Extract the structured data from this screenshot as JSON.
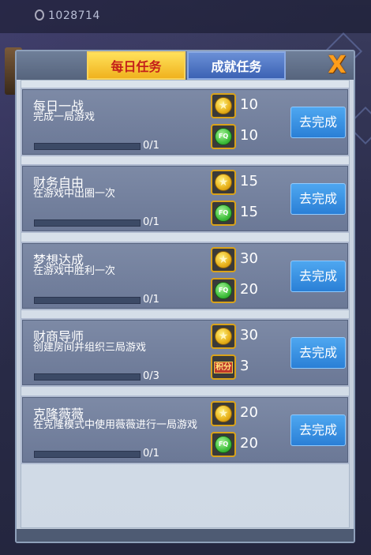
{
  "background": {
    "currency_amount": "1028714"
  },
  "tabs": {
    "daily": "每日任务",
    "achievement": "成就任务"
  },
  "close_label": "X",
  "go_label": "去完成",
  "tasks": [
    {
      "title": "每日一战",
      "description": "完成一局游戏",
      "progress": "0/1",
      "progress_fraction": 0,
      "rewards": [
        {
          "icon": "gold-coin-icon",
          "value": "10"
        },
        {
          "icon": "fq-coin-icon",
          "value": "10"
        }
      ]
    },
    {
      "title": "财务自由",
      "description": "在游戏中出圈一次",
      "progress": "0/1",
      "progress_fraction": 0,
      "rewards": [
        {
          "icon": "gold-coin-icon",
          "value": "15"
        },
        {
          "icon": "fq-coin-icon",
          "value": "15"
        }
      ]
    },
    {
      "title": "梦想达成",
      "description": "在游戏中胜利一次",
      "progress": "0/1",
      "progress_fraction": 0,
      "rewards": [
        {
          "icon": "gold-coin-icon",
          "value": "30"
        },
        {
          "icon": "fq-coin-icon",
          "value": "20"
        }
      ]
    },
    {
      "title": "财商导师",
      "description": "创建房间并组织三局游戏",
      "progress": "0/3",
      "progress_fraction": 0,
      "rewards": [
        {
          "icon": "gold-coin-icon",
          "value": "30"
        },
        {
          "icon": "points-icon",
          "label": "积分",
          "value": "3"
        }
      ]
    },
    {
      "title": "克隆薇薇",
      "description": "在克隆模式中使用薇薇进行一局游戏",
      "progress": "0/1",
      "progress_fraction": 0,
      "rewards": [
        {
          "icon": "gold-coin-icon",
          "value": "20"
        },
        {
          "icon": "fq-coin-icon",
          "value": "20"
        }
      ]
    }
  ]
}
